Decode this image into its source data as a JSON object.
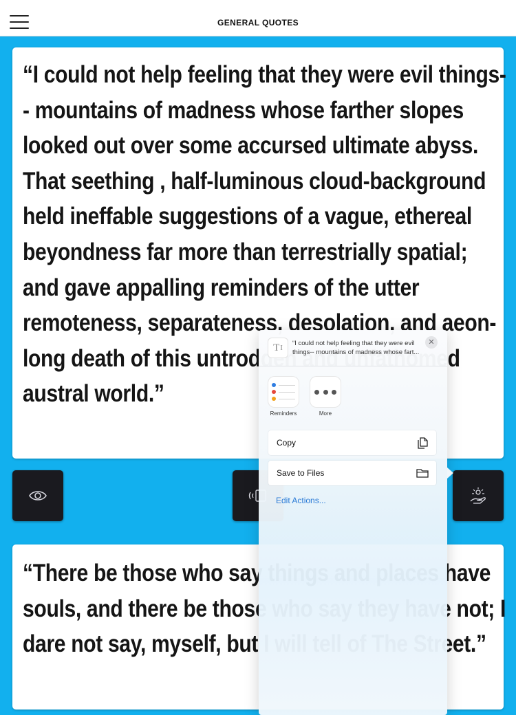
{
  "header": {
    "title": "GENERAL QUOTES"
  },
  "quotes": [
    {
      "text": "“I could not help feeling that they were evil things-- mountains of madness whose farther slopes looked out over some accursed ultimate abyss. That seething , half-luminous cloud-background held ineffable suggestions of a vague, ethereal beyondness far more than terrestrially spatial; and gave appalling reminders of the utter remoteness, separateness, desolation, and aeon-long death of this untrodden and unfathomed austral world.”"
    },
    {
      "text": "“There be those who say things and places have souls, and there be those who say they have not; I dare not say, myself, but I will tell of The Street.”"
    }
  ],
  "action_buttons": [
    {
      "icon": "eye-icon"
    },
    {
      "icon": "image-share-icon"
    },
    {
      "icon": "hand-icon"
    }
  ],
  "share_sheet": {
    "preview_text": "“I could not help feeling that they were evil things-- mountains of madness whose fart...",
    "preview_icon": "text-icon",
    "apps": [
      {
        "label": "Reminders",
        "icon": "reminders-icon"
      },
      {
        "label": "More",
        "icon": "more-icon"
      }
    ],
    "actions": [
      {
        "label": "Copy",
        "icon": "copy-icon"
      },
      {
        "label": "Save to Files",
        "icon": "folder-icon"
      }
    ],
    "edit_actions_label": "Edit Actions..."
  },
  "colors": {
    "background": "#12b0ee",
    "button_dark": "#1a1a1f",
    "link_blue": "#2b7bd6"
  }
}
